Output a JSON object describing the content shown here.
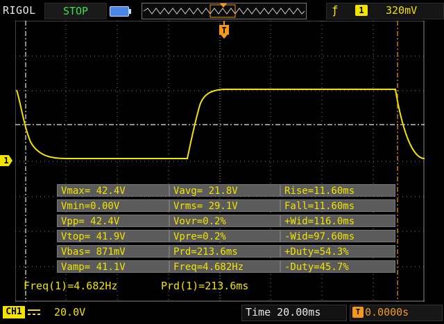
{
  "header": {
    "brand": "RIGOL",
    "run_status": "STOP",
    "trigger": {
      "edge_icon": "rising-edge-icon",
      "channel": "1",
      "level": "320mV"
    }
  },
  "channel": {
    "marker": "1",
    "label": "CH1",
    "coupling_icon": "dc-coupling-icon",
    "scale": "20.0V"
  },
  "timebase": {
    "time": "Time 20.00ms",
    "offset": "0.0000s",
    "offset_icon": "T"
  },
  "trigger_marker": "T",
  "colors": {
    "trace": "#f2e400",
    "grid": "#8a8a8a",
    "trigger": "#f39a1e",
    "stop": "#3ee04a",
    "table_bg": "#5b5b5b"
  },
  "measurements": {
    "col1": [
      "Vmax= 42.4V",
      "Vmin=0.00V",
      "Vpp= 42.4V",
      "Vtop= 41.9V",
      "Vbas= 871mV",
      "Vamp= 41.1V"
    ],
    "col2": [
      "Vavg= 21.8V",
      "Vrms= 29.1V",
      "Vovr=0.2%",
      "Vpre=0.2%",
      "Prd=213.6ms",
      "Freq=4.682Hz"
    ],
    "col3": [
      "Rise=11.60ms",
      "Fall=11.60ms",
      "+Wid=116.0ms",
      "-Wid=97.60ms",
      "+Duty=54.3%",
      "-Duty=45.7%"
    ]
  },
  "footer": {
    "freq": "Freq(1)=4.682Hz",
    "prd": "Prd(1)=213.6ms"
  }
}
